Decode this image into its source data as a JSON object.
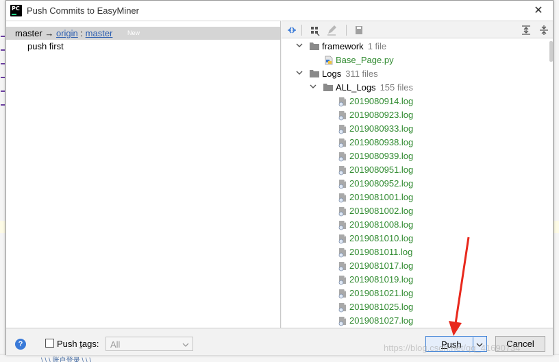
{
  "window": {
    "title": "Push Commits to EasyMiner",
    "app_icon_text": "PC"
  },
  "left": {
    "branch": {
      "local": "master",
      "arrow": "→",
      "remote": "origin",
      "separator": ":",
      "target": "master",
      "badge": "New"
    },
    "commits": [
      {
        "message": "push first"
      }
    ]
  },
  "toolbar": {
    "icons": [
      "expand-icon",
      "group-icon",
      "edit-icon",
      "save-icon",
      "expand-all-icon",
      "collapse-all-icon"
    ]
  },
  "tree": {
    "framework": {
      "name": "framework",
      "count": "1 file"
    },
    "base_page": {
      "name": "Base_Page.py"
    },
    "logs": {
      "name": "Logs",
      "count": "311 files"
    },
    "all_logs": {
      "name": "ALL_Logs",
      "count": "155 files"
    },
    "log_files": [
      "2019080914.log",
      "2019080923.log",
      "2019080933.log",
      "2019080938.log",
      "2019080939.log",
      "2019080951.log",
      "2019080952.log",
      "2019081001.log",
      "2019081002.log",
      "2019081008.log",
      "2019081010.log",
      "2019081011.log",
      "2019081017.log",
      "2019081019.log",
      "2019081021.log",
      "2019081025.log",
      "2019081027.log"
    ],
    "file_color": "#2f8a2f"
  },
  "bottom": {
    "help": "?",
    "push_tags_pre": "Push ",
    "push_tags_u": "t",
    "push_tags_post": "ags:",
    "tags_select_value": "All",
    "push_pre": "",
    "push_u": "P",
    "push_post": "ush",
    "cancel": "Cancel"
  },
  "background": {
    "bottom_fragment": "\\ \\ \\ 账户登录 \\ \\ \\",
    "watermark": "https://blog.csdn.net/qq_41690734"
  },
  "colors": {
    "accent": "#3c7fd4",
    "annotation": "#e8281c"
  }
}
